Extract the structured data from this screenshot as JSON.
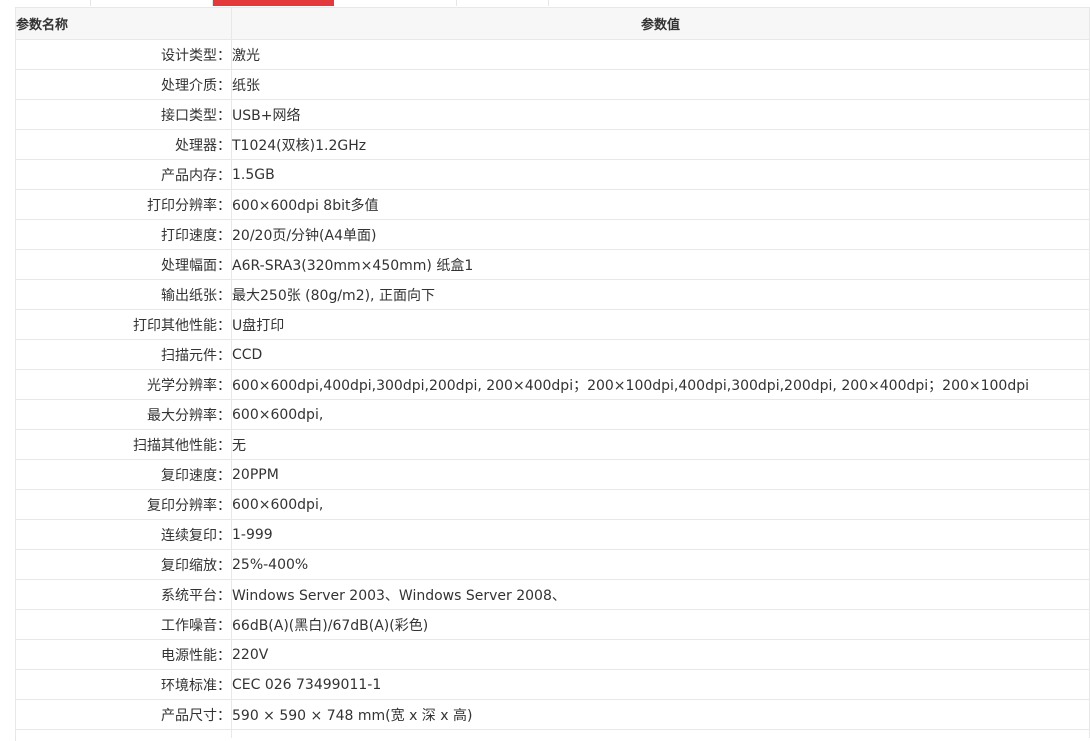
{
  "table": {
    "header": {
      "name": "参数名称",
      "value": "参数值"
    },
    "rows": [
      {
        "key": "设计类型：",
        "value": "激光"
      },
      {
        "key": "处理介质：",
        "value": "纸张"
      },
      {
        "key": "接口类型：",
        "value": "USB+网络"
      },
      {
        "key": "处理器：",
        "value": "T1024(双核)1.2GHz"
      },
      {
        "key": "产品内存：",
        "value": "1.5GB"
      },
      {
        "key": "打印分辨率：",
        "value": "600×600dpi 8bit多值"
      },
      {
        "key": "打印速度：",
        "value": "20/20页/分钟(A4单面)"
      },
      {
        "key": "处理幅面：",
        "value": "A6R-SRA3(320mm×450mm) 纸盒1"
      },
      {
        "key": "输出纸张：",
        "value": "最大250张 (80g/m2), 正面向下"
      },
      {
        "key": "打印其他性能：",
        "value": "U盘打印"
      },
      {
        "key": "扫描元件：",
        "value": "CCD"
      },
      {
        "key": "光学分辨率：",
        "value": "600×600dpi,400dpi,300dpi,200dpi, 200×400dpi；200×100dpi,400dpi,300dpi,200dpi, 200×400dpi；200×100dpi"
      },
      {
        "key": "最大分辨率：",
        "value": "600×600dpi,"
      },
      {
        "key": "扫描其他性能：",
        "value": "无"
      },
      {
        "key": "复印速度：",
        "value": "20PPM"
      },
      {
        "key": "复印分辨率：",
        "value": "600×600dpi,"
      },
      {
        "key": "连续复印：",
        "value": "1-999"
      },
      {
        "key": "复印缩放：",
        "value": "25%-400%"
      },
      {
        "key": "系统平台：",
        "value": "Windows Server 2003、Windows Server 2008、"
      },
      {
        "key": "工作噪音：",
        "value": "66dB(A)(黑白)/67dB(A)(彩色)"
      },
      {
        "key": "电源性能：",
        "value": "220V"
      },
      {
        "key": "环境标准：",
        "value": "CEC 026 73499011-1"
      },
      {
        "key": "产品尺寸：",
        "value": "590 × 590 × 748 mm(宽 x 深 x 高)"
      }
    ]
  },
  "colors": {
    "accent": "#e4393c",
    "header_bg": "#f7f7f7",
    "border": "#e8e8e8"
  }
}
